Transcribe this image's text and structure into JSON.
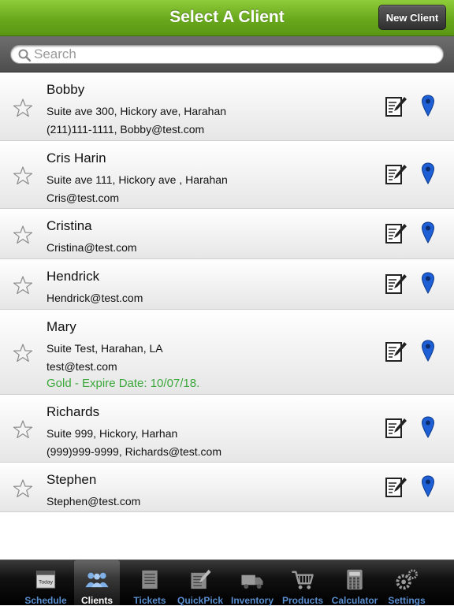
{
  "header": {
    "title": "Select A Client",
    "new_client_label": "New Client"
  },
  "search": {
    "placeholder": "Search",
    "value": ""
  },
  "clients": [
    {
      "name": "Bobby",
      "lines": [
        "Suite ave 300, Hickory ave, Harahan",
        "(211)111-1111, Bobby@test.com"
      ],
      "gold": ""
    },
    {
      "name": "Cris Harin",
      "lines": [
        "Suite ave 111, Hickory ave , Harahan",
        "Cris@test.com"
      ],
      "gold": ""
    },
    {
      "name": "Cristina",
      "lines": [
        "Cristina@test.com"
      ],
      "gold": ""
    },
    {
      "name": "Hendrick",
      "lines": [
        "Hendrick@test.com"
      ],
      "gold": ""
    },
    {
      "name": "Mary",
      "lines": [
        "Suite Test, Harahan, LA",
        "test@test.com"
      ],
      "gold": "Gold - Expire Date: 10/07/18."
    },
    {
      "name": "Richards",
      "lines": [
        "Suite 999, Hickory, Harhan",
        "(999)999-9999, Richards@test.com"
      ],
      "gold": ""
    },
    {
      "name": "Stephen",
      "lines": [
        "Stephen@test.com"
      ],
      "gold": ""
    }
  ],
  "tabs": [
    {
      "label": "Schedule",
      "icon": "calendar-icon",
      "active": false,
      "icon_text": "Today"
    },
    {
      "label": "Clients",
      "icon": "people-icon",
      "active": true
    },
    {
      "label": "Tickets",
      "icon": "ticket-list-icon",
      "active": false
    },
    {
      "label": "QuickPick",
      "icon": "quickpick-icon",
      "active": false
    },
    {
      "label": "Inventory",
      "icon": "truck-icon",
      "active": false
    },
    {
      "label": "Products",
      "icon": "cart-icon",
      "active": false
    },
    {
      "label": "Calculator",
      "icon": "calculator-icon",
      "active": false
    },
    {
      "label": "Settings",
      "icon": "gears-icon",
      "active": false
    }
  ],
  "colors": {
    "header_green": "#68a81c",
    "gold_text": "#3aa83a",
    "tab_label": "#5a8fd0",
    "pin_blue": "#1f5fd6"
  }
}
